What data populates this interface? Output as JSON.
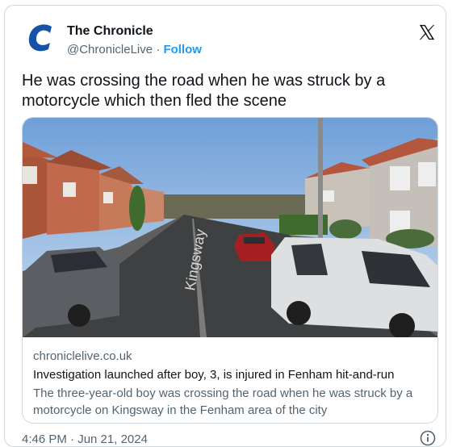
{
  "account": {
    "name": "The Chronicle",
    "handle": "@ChronicleLive",
    "separator": "·",
    "follow_label": "Follow",
    "logo_color": "#1553a6"
  },
  "tweet": {
    "text": "He was crossing the road when he was struck by a motorcycle which then fled the scene",
    "timestamp": "4:46 PM · Jun 21, 2024"
  },
  "link_card": {
    "domain": "chroniclelive.co.uk",
    "headline": "Investigation launched after boy, 3, is injured in Fenham hit-and-run",
    "description": "The three-year-old boy was crossing the road when he was struck by a motorcycle on Kingsway in the Fenham area of the city",
    "photo_road_text": "Kingsway"
  },
  "icons": {
    "logo": "chronicle-logo-icon",
    "x": "x-logo-icon",
    "info": "info-icon"
  }
}
